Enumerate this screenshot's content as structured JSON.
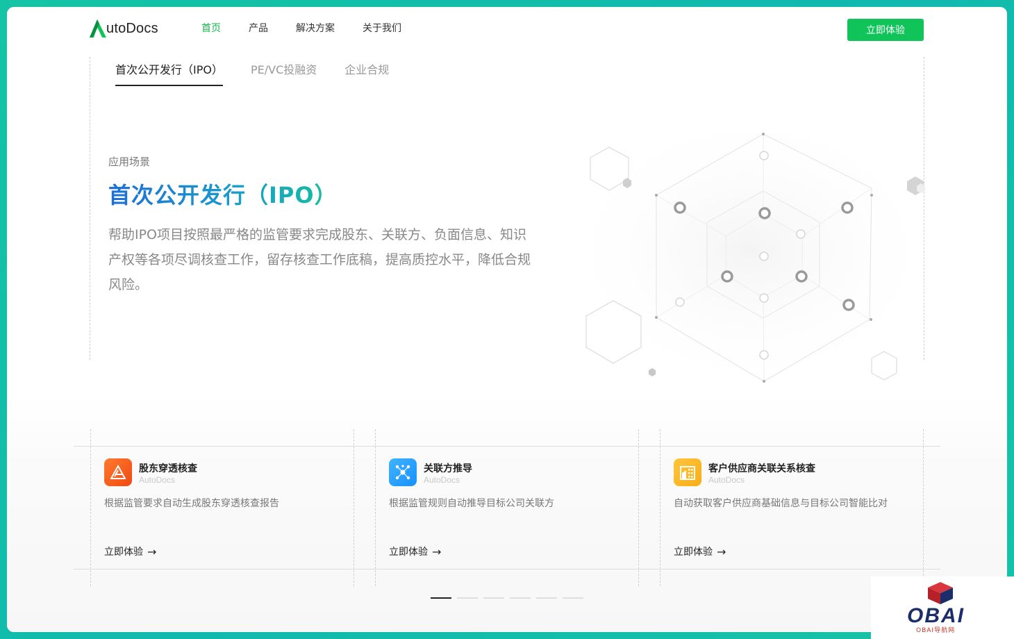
{
  "brand": {
    "name": "utoDocs",
    "logo_icon": "autodocs-a-logo"
  },
  "nav": {
    "items": [
      {
        "label": "首页",
        "active": true
      },
      {
        "label": "产品",
        "active": false
      },
      {
        "label": "解决方案",
        "active": false
      },
      {
        "label": "关于我们",
        "active": false
      }
    ],
    "cta_label": "立即体验"
  },
  "tabs": [
    {
      "label": "首次公开发行（IPO）",
      "active": true
    },
    {
      "label": "PE/VC投融资",
      "active": false
    },
    {
      "label": "企业合规",
      "active": false
    }
  ],
  "hero": {
    "eyebrow": "应用场景",
    "title": "首次公开发行（IPO）",
    "description": "帮助IPO项目按照最严格的监管要求完成股东、关联方、负面信息、知识产权等各项尽调核查工作，留存核查工作底稿，提高质控水平，降低合规风险。"
  },
  "cards": [
    {
      "title": "股东穿透核查",
      "subtitle": "AutoDocs",
      "description": "根据监管要求自动生成股东穿透核查报告",
      "link": "立即体验",
      "icon": "shareholder-penetration-icon",
      "color": "#fa541c"
    },
    {
      "title": "关联方推导",
      "subtitle": "AutoDocs",
      "description": "根据监管规则自动推导目标公司关联方",
      "link": "立即体验",
      "icon": "related-party-network-icon",
      "color": "#1890ff"
    },
    {
      "title": "客户供应商关联关系核查",
      "subtitle": "AutoDocs",
      "description": "自动获取客户供应商基础信息与目标公司智能比对",
      "link": "立即体验",
      "icon": "building-icon",
      "color": "#faad14"
    }
  ],
  "pagination": {
    "total": 6,
    "active_index": 0
  },
  "watermark": {
    "text": "OBAI",
    "sub": "OBAI导航网"
  },
  "colors": {
    "accent": "#10c45a",
    "background": "#14c4a4"
  }
}
